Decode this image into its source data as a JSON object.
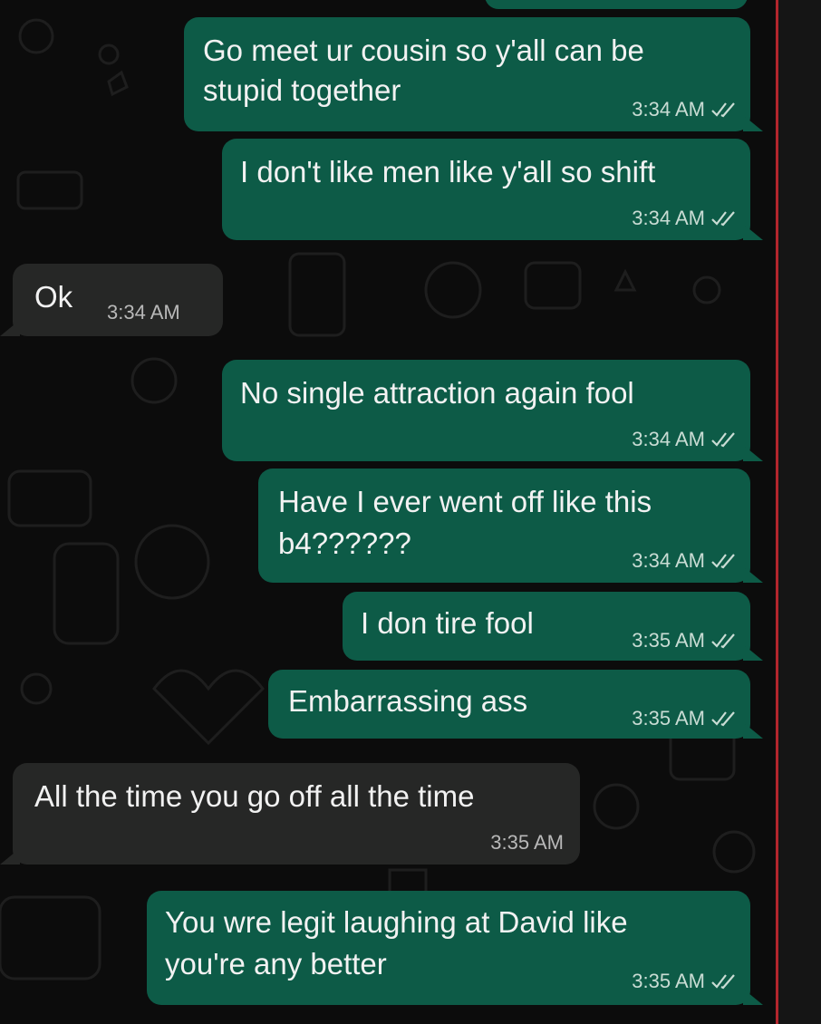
{
  "colors": {
    "outgoing_bubble": "#0d5b47",
    "incoming_bubble": "#262726",
    "background": "#0c0c0c",
    "text": "#f2f2f2",
    "read_receipt": "#c9dcd4",
    "side_line": "#b3262d"
  },
  "messages": [
    {
      "direction": "outgoing",
      "line1": "Go meet ur cousin so y'all can be",
      "line2": "stupid together",
      "time": "3:34 AM",
      "status_icon": "double-check-icon"
    },
    {
      "direction": "outgoing",
      "line1": "I don't like men like y'all so shift",
      "time": "3:34 AM",
      "status_icon": "double-check-icon"
    },
    {
      "direction": "incoming",
      "line1": "Ok",
      "time": "3:34 AM"
    },
    {
      "direction": "outgoing",
      "line1": "No single attraction again fool",
      "time": "3:34 AM",
      "status_icon": "double-check-icon"
    },
    {
      "direction": "outgoing",
      "line1": "Have I ever went off like this",
      "line2": "b4??????",
      "time": "3:34 AM",
      "status_icon": "double-check-icon"
    },
    {
      "direction": "outgoing",
      "line1": "I don tire fool",
      "time": "3:35 AM",
      "status_icon": "double-check-icon"
    },
    {
      "direction": "outgoing",
      "line1": "Embarrassing ass",
      "time": "3:35 AM",
      "status_icon": "double-check-icon"
    },
    {
      "direction": "incoming",
      "line1": "All the time you go off all the time",
      "time": "3:35 AM"
    },
    {
      "direction": "outgoing",
      "line1": "You wre legit laughing at David like",
      "line2": "you're any better",
      "time": "3:35 AM",
      "status_icon": "double-check-icon"
    }
  ]
}
